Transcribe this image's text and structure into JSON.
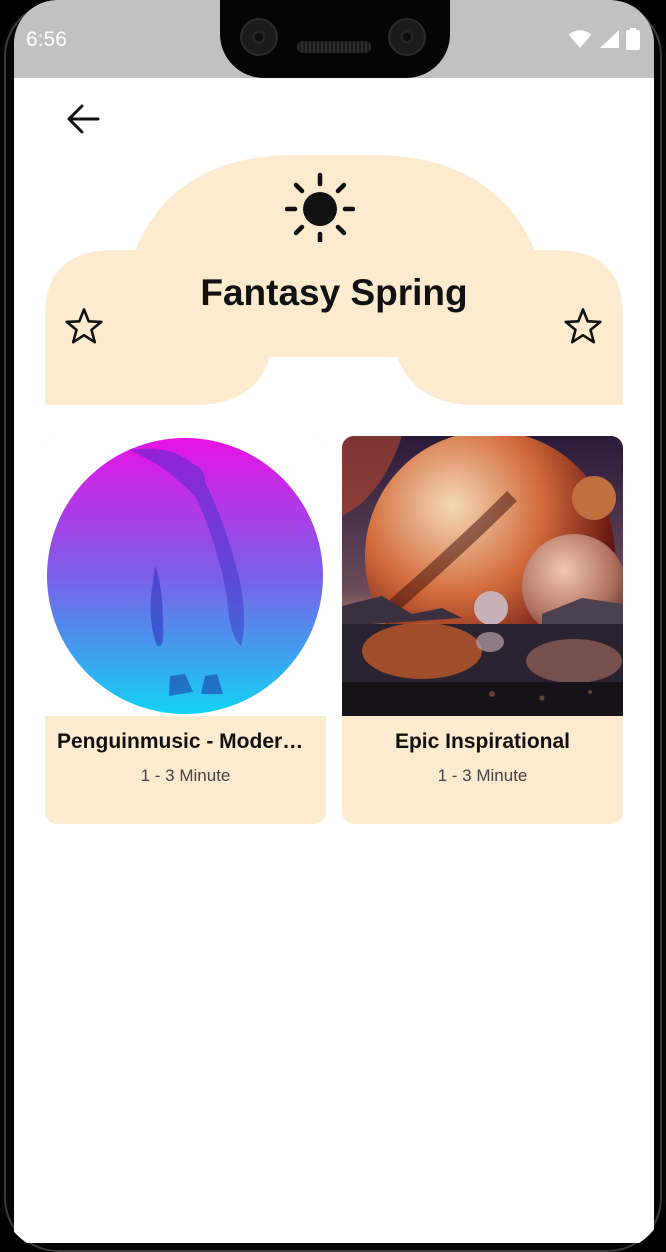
{
  "status_bar": {
    "time": "6:56",
    "icons": [
      "wifi-icon",
      "cellular-signal-icon",
      "battery-icon"
    ]
  },
  "header": {
    "back_icon": "arrow-left-icon"
  },
  "banner": {
    "title": "Fantasy Spring",
    "icon": "sun-icon",
    "left_icon": "star-outline-icon",
    "right_icon": "star-outline-icon",
    "color": "#fdebd0"
  },
  "cards": [
    {
      "title": "Penguinmusic - Modern Chillout",
      "subtitle": "1 - 3 Minute",
      "image": "penguin-gradient-artwork"
    },
    {
      "title": "Epic Inspirational",
      "subtitle": "1 - 3 Minute",
      "image": "planets-landscape-artwork"
    }
  ],
  "colors": {
    "accent": "#fdebd0",
    "text": "#111111",
    "statusbar": "#c1c1c1"
  }
}
